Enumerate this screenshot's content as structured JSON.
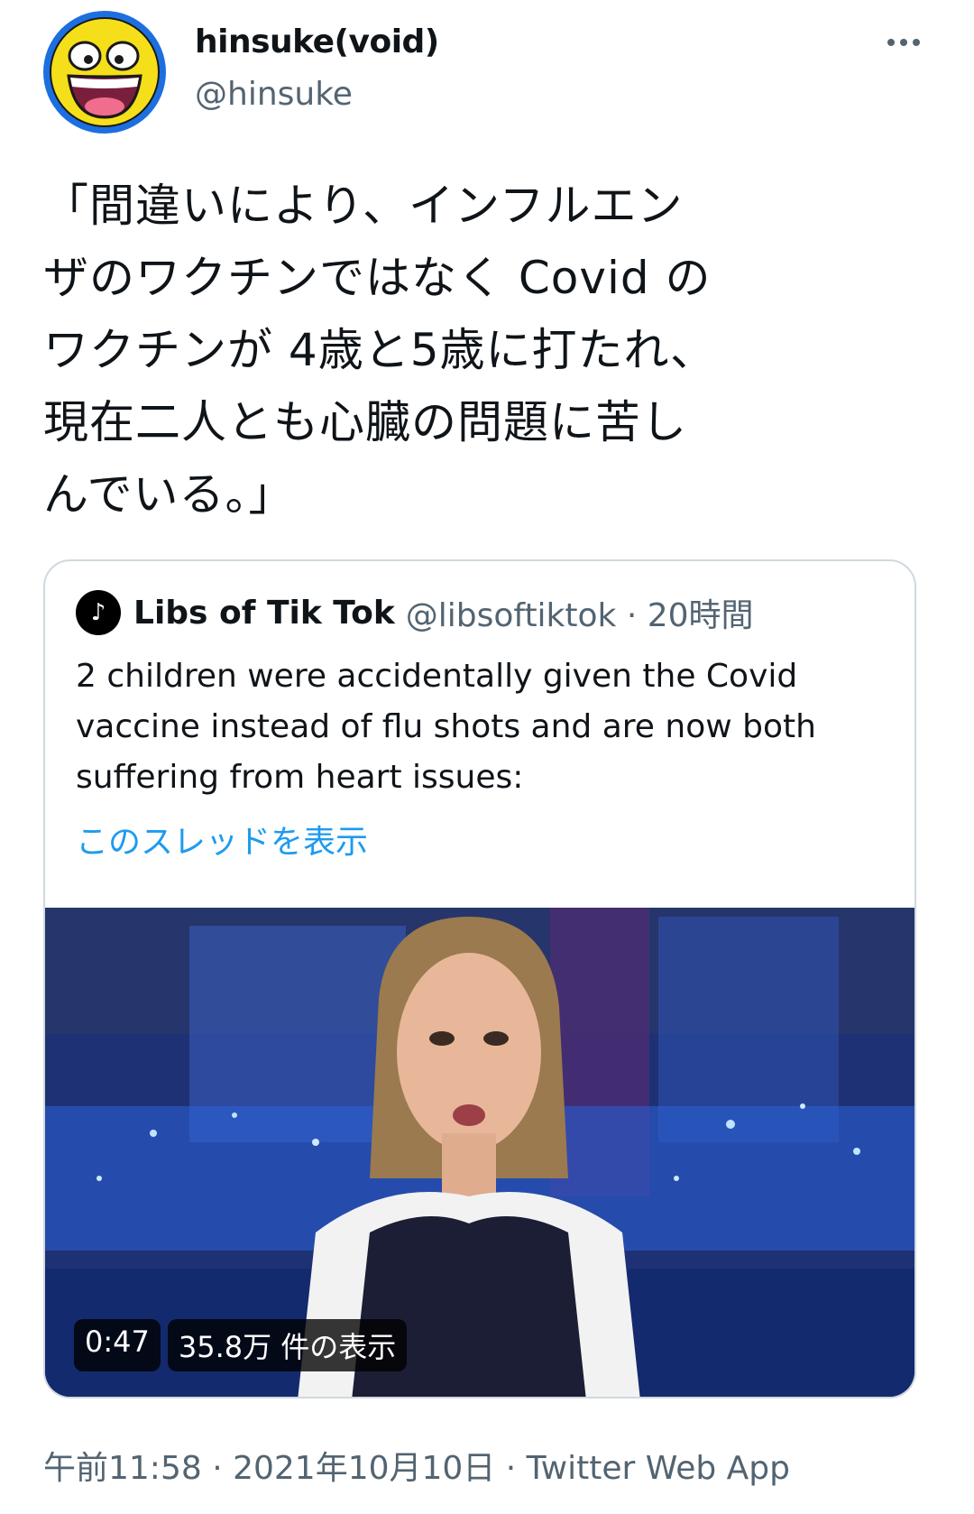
{
  "author": {
    "display_name": "hinsuke(void)",
    "handle": "@hinsuke",
    "avatar_icon": "smiley-face-icon"
  },
  "tweet": {
    "text": "「間違いにより、インフルエン\nザのワクチンではなく Covid の\nワクチンが 4歳と5歳に打たれ、\n現在二人とも心臓の問題に苦し\nんでいる。」"
  },
  "quoted_tweet": {
    "display_name": "Libs of Tik Tok",
    "meta": "@libsoftiktok · 20時間",
    "avatar_text": "Libs of TikTok",
    "text": "2 children were accidentally given the Covid vaccine instead of flu shots and are now both suffering from heart issues:",
    "thread_link": "このスレッドを表示",
    "video": {
      "duration": "0:47",
      "views": "35.8万 件の表示"
    }
  },
  "footer": {
    "timestamp": "午前11:58 · 2021年10月10日 · Twitter Web App"
  },
  "colors": {
    "link": "#1d9bf0",
    "secondary_text": "#536471",
    "border": "#cfd9de"
  }
}
